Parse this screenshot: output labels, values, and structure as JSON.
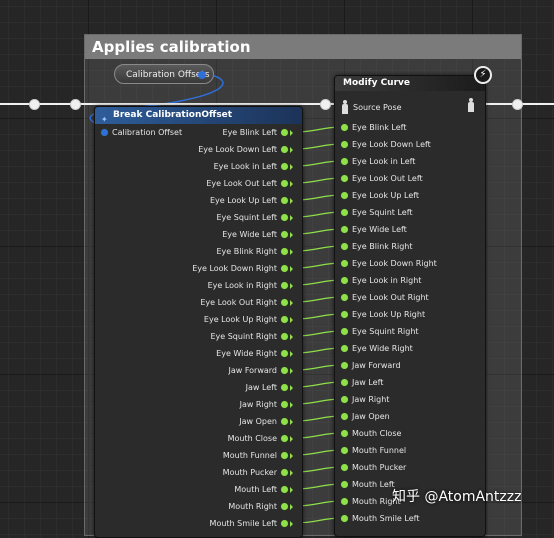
{
  "comment": {
    "title": "Applies calibration"
  },
  "variable": {
    "label": "Calibration Offsets"
  },
  "break_node": {
    "title": "Break CalibrationOffset",
    "input_label": "Calibration Offset",
    "outputs": [
      "Eye Blink Left",
      "Eye Look Down Left",
      "Eye Look in Left",
      "Eye Look Out Left",
      "Eye Look Up Left",
      "Eye Squint Left",
      "Eye Wide Left",
      "Eye Blink Right",
      "Eye Look Down Right",
      "Eye Look in Right",
      "Eye Look Out Right",
      "Eye Look Up Right",
      "Eye Squint Right",
      "Eye Wide Right",
      "Jaw Forward",
      "Jaw Left",
      "Jaw Right",
      "Jaw Open",
      "Mouth Close",
      "Mouth Funnel",
      "Mouth Pucker",
      "Mouth Left",
      "Mouth Right",
      "Mouth Smile Left"
    ]
  },
  "modify_node": {
    "title": "Modify Curve",
    "source_pose": "Source Pose",
    "inputs": [
      "Eye Blink Left",
      "Eye Look Down Left",
      "Eye Look in Left",
      "Eye Look Out Left",
      "Eye Look Up Left",
      "Eye Squint Left",
      "Eye Wide Left",
      "Eye Blink Right",
      "Eye Look Down Right",
      "Eye Look in Right",
      "Eye Look Out Right",
      "Eye Look Up Right",
      "Eye Squint Right",
      "Eye Wide Right",
      "Jaw Forward",
      "Jaw Left",
      "Jaw Right",
      "Jaw Open",
      "Mouth Close",
      "Mouth Funnel",
      "Mouth Pucker",
      "Mouth Left",
      "Mouth Right",
      "Mouth Smile Left"
    ]
  },
  "watermark": "知乎 @AtomAntzzz",
  "icons": {
    "head_icon": "struct-break-icon",
    "flash_icon": "lightning-icon",
    "pose_icon": "pose-figure-icon"
  },
  "colors": {
    "float_pin": "#8fe04a",
    "struct_pin": "#2f6fd8",
    "exec": "#f0f0f0"
  }
}
